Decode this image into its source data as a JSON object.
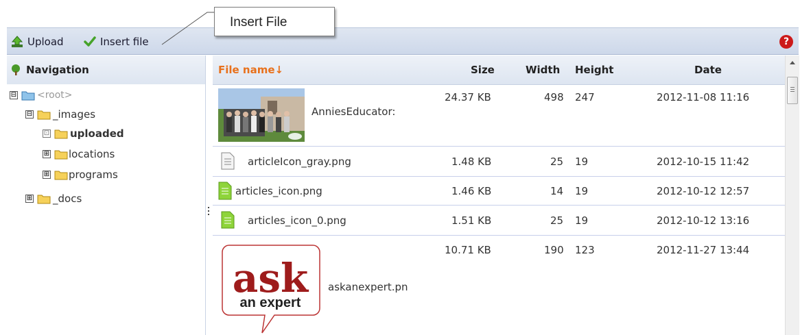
{
  "callout": {
    "label": "Insert File"
  },
  "toolbar": {
    "upload_label": "Upload",
    "insert_label": "Insert file"
  },
  "navigation": {
    "title": "Navigation",
    "tree": [
      {
        "label": "<root>",
        "expander": "⊟"
      },
      {
        "label": "_images",
        "expander": "⊟"
      },
      {
        "label": "uploaded",
        "expander": "⊡",
        "selected": true
      },
      {
        "label": "locations",
        "expander": "⊞"
      },
      {
        "label": "programs",
        "expander": "⊞"
      },
      {
        "label": "_docs",
        "expander": "⊞"
      }
    ]
  },
  "grid": {
    "columns": {
      "name": "File name↓",
      "size": "Size",
      "width": "Width",
      "height": "Height",
      "date": "Date"
    },
    "rows": [
      {
        "name": "AnniesEducator:",
        "size": "24.37 KB",
        "width": "498",
        "height": "247",
        "date": "2012-11-08 11:16",
        "icon": "photo-thumbnail"
      },
      {
        "name": "articleIcon_gray.png",
        "size": "1.48 KB",
        "width": "25",
        "height": "19",
        "date": "2012-10-15 11:42",
        "icon": "gray-doc-icon"
      },
      {
        "name": "articles_icon.png",
        "size": "1.46 KB",
        "width": "14",
        "height": "19",
        "date": "2012-10-12 12:57",
        "icon": "green-doc-icon"
      },
      {
        "name": "articles_icon_0.png",
        "size": "1.51 KB",
        "width": "25",
        "height": "19",
        "date": "2012-10-12 13:16",
        "icon": "green-doc-icon"
      },
      {
        "name": "askanexpert.pn",
        "size": "10.71 KB",
        "width": "190",
        "height": "123",
        "date": "2012-11-27 13:44",
        "icon": "ask-an-expert-logo",
        "logo": {
          "big": "ask",
          "small": "an expert"
        }
      }
    ]
  },
  "colors": {
    "sort_header": "#e8711c",
    "help": "#cc1a1a",
    "row_border": "#c7cfea",
    "toolbar_bg": "#d6dfee"
  }
}
